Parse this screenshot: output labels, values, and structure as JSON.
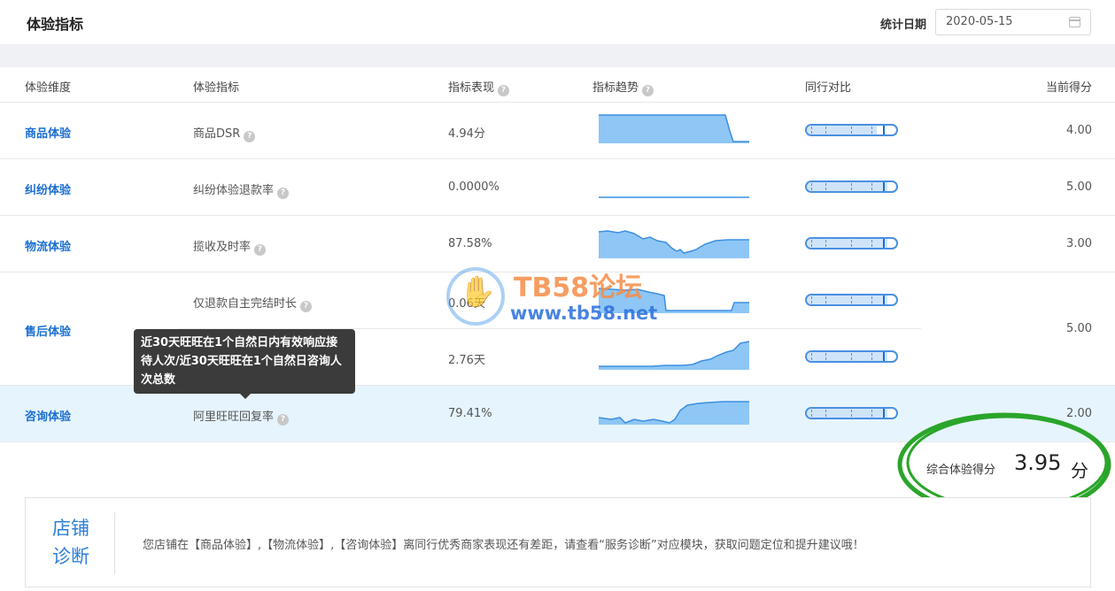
{
  "header": {
    "title": "体验指标",
    "date_label": "统计日期",
    "date_value": "2020-05-15"
  },
  "table": {
    "headers": {
      "dimension": "体验维度",
      "metric": "体验指标",
      "performance": "指标表现",
      "trend": "指标趋势",
      "compare": "同行对比",
      "score": "当前得分"
    },
    "rows": [
      {
        "dimension": "商品体验",
        "metric": "商品DSR",
        "value": "4.94分",
        "score": "4.00",
        "compare_level": 0.78
      },
      {
        "dimension": "纠纷体验",
        "metric": "纠纷体验退款率",
        "value": "0.0000%",
        "score": "5.00",
        "compare_level": 0.9
      },
      {
        "dimension": "物流体验",
        "metric": "揽收及时率",
        "value": "87.58%",
        "score": "3.00",
        "compare_level": 0.9
      },
      {
        "dimension": "售后体验",
        "metric": "仅退款自主完结时长",
        "value": "0.06天",
        "score": "5.00",
        "compare_level": 0.9
      },
      {
        "dimension": "",
        "metric": "",
        "value": "2.76天",
        "score": "",
        "compare_level": 0.9
      },
      {
        "dimension": "咨询体验",
        "metric": "阿里旺旺回复率",
        "value": "79.41%",
        "score": "2.00",
        "compare_level": 0.9
      }
    ]
  },
  "tooltip": {
    "text": "近30天旺旺在1个自然日内有效响应接待人次/近30天旺旺在1个自然日咨询人次总数"
  },
  "summary": {
    "label": "综合体验得分",
    "value": "3.95",
    "unit": "分"
  },
  "diagnosis": {
    "title": "店铺诊断",
    "text": "您店铺在【商品体验】,【物流体验】,【咨询体验】离同行优秀商家表现还有差距，请查看“服务诊断”对应模块，获取问题定位和提升建议哦！"
  },
  "watermark": {
    "title": "TB58论坛",
    "url": "www.tb58.net"
  },
  "icons": {
    "help": "question-icon",
    "calendar": "calendar-icon",
    "hand": "hand-logo-icon"
  },
  "colors": {
    "accent": "#1a6fd1",
    "chart_fill": "#8ec6f5",
    "chart_line": "#3d8fe0",
    "highlight_row": "#e6f4fd",
    "annotation_circle": "#2aa52a"
  }
}
